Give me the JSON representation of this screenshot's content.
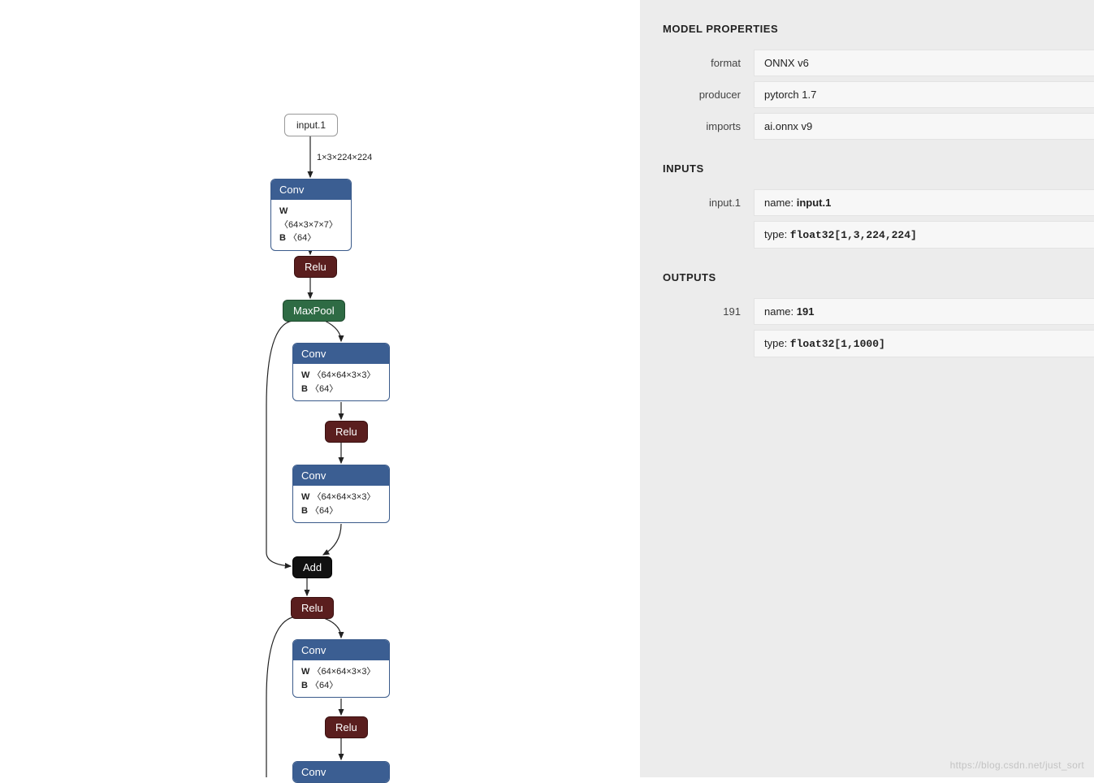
{
  "graph": {
    "input_node": "input.1",
    "input_shape": "1×3×224×224",
    "conv1": {
      "title": "Conv",
      "w": "〈64×3×7×7〉",
      "b": "〈64〉"
    },
    "relu": "Relu",
    "maxpool": "MaxPool",
    "conv2": {
      "title": "Conv",
      "w": "〈64×64×3×3〉",
      "b": "〈64〉"
    },
    "conv3": {
      "title": "Conv",
      "w": "〈64×64×3×3〉",
      "b": "〈64〉"
    },
    "add": "Add",
    "conv4": {
      "title": "Conv",
      "w": "〈64×64×3×3〉",
      "b": "〈64〉"
    },
    "conv5_title": "Conv"
  },
  "panel": {
    "title_model": "MODEL PROPERTIES",
    "format_label": "format",
    "format_val": "ONNX v6",
    "producer_label": "producer",
    "producer_val": "pytorch 1.7",
    "imports_label": "imports",
    "imports_val": "ai.onnx v9",
    "title_inputs": "INPUTS",
    "input_name_label": "input.1",
    "input_name_prefix": "name: ",
    "input_name_val": "input.1",
    "input_type_prefix": "type: ",
    "input_type_val": "float32[1,3,224,224]",
    "title_outputs": "OUTPUTS",
    "output_name_label": "191",
    "output_name_prefix": "name: ",
    "output_name_val": "191",
    "output_type_prefix": "type: ",
    "output_type_val": "float32[1,1000]"
  },
  "watermark": "https://blog.csdn.net/just_sort"
}
